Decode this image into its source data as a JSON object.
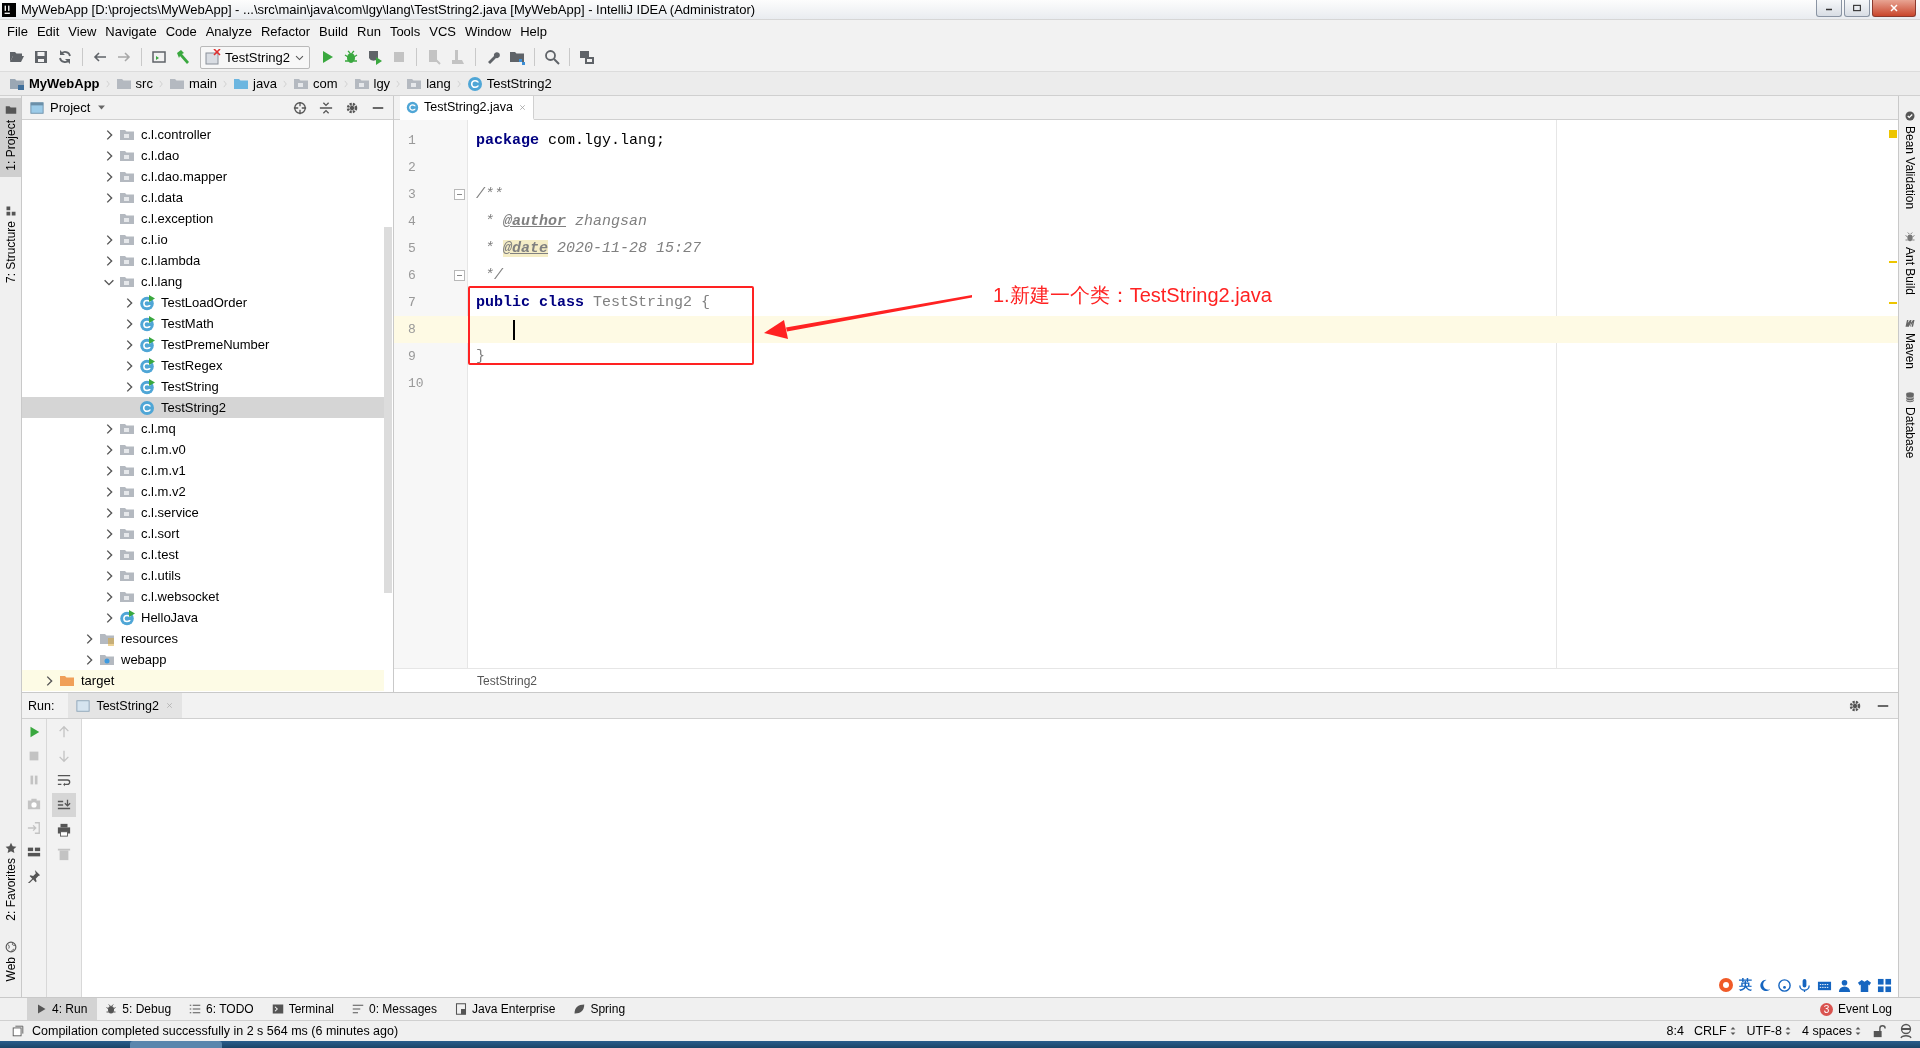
{
  "window": {
    "title": "MyWebApp [D:\\projects\\MyWebApp] - ...\\src\\main\\java\\com\\lgy\\lang\\TestString2.java [MyWebApp] - IntelliJ IDEA (Administrator)"
  },
  "menu": [
    "File",
    "Edit",
    "View",
    "Navigate",
    "Code",
    "Analyze",
    "Refactor",
    "Build",
    "Run",
    "Tools",
    "VCS",
    "Window",
    "Help"
  ],
  "toolbar": {
    "run_configuration": "TestString2"
  },
  "breadcrumbs": [
    {
      "label": "MyWebApp",
      "kind": "module"
    },
    {
      "label": "src",
      "kind": "folder"
    },
    {
      "label": "main",
      "kind": "folder"
    },
    {
      "label": "java",
      "kind": "source-folder"
    },
    {
      "label": "com",
      "kind": "package"
    },
    {
      "label": "lgy",
      "kind": "package"
    },
    {
      "label": "lang",
      "kind": "package"
    },
    {
      "label": "TestString2",
      "kind": "class"
    }
  ],
  "left_stripe": {
    "top": [
      {
        "label": "1: Project",
        "selected": true
      },
      {
        "label": "7: Structure",
        "selected": false
      }
    ],
    "bottom": [
      {
        "label": "2: Favorites",
        "selected": false
      },
      {
        "label": "Web",
        "selected": false
      }
    ]
  },
  "project": {
    "title": "Project",
    "tree": [
      {
        "children": [
          {
            "children": [
              {
                "children": [
                  {
                    "label": "c.l.controller",
                    "kind": "package",
                    "expandable": true,
                    "expanded": false,
                    "selected": false
                  },
                  {
                    "label": "c.l.dao",
                    "kind": "package",
                    "expandable": true,
                    "expanded": false,
                    "selected": false
                  },
                  {
                    "label": "c.l.dao.mapper",
                    "kind": "package",
                    "expandable": true,
                    "expanded": false,
                    "selected": false
                  },
                  {
                    "label": "c.l.data",
                    "kind": "package",
                    "expandable": true,
                    "expanded": false,
                    "selected": false
                  },
                  {
                    "label": "c.l.exception",
                    "kind": "package",
                    "expandable": false,
                    "selected": false
                  },
                  {
                    "label": "c.l.io",
                    "kind": "package",
                    "expandable": true,
                    "expanded": false,
                    "selected": false
                  },
                  {
                    "label": "c.l.lambda",
                    "kind": "package",
                    "expandable": true,
                    "expanded": false,
                    "selected": false
                  },
                  {
                    "label": "c.l.lang",
                    "kind": "package",
                    "expandable": true,
                    "expanded": true,
                    "selected": false,
                    "children": [
                      {
                        "label": "TestLoadOrder",
                        "kind": "main-class",
                        "expandable": true,
                        "expanded": false,
                        "selected": false
                      },
                      {
                        "label": "TestMath",
                        "kind": "main-class",
                        "expandable": true,
                        "expanded": false,
                        "selected": false
                      },
                      {
                        "label": "TestPremeNumber",
                        "kind": "main-class",
                        "expandable": true,
                        "expanded": false,
                        "selected": false
                      },
                      {
                        "label": "TestRegex",
                        "kind": "main-class",
                        "expandable": true,
                        "expanded": false,
                        "selected": false
                      },
                      {
                        "label": "TestString",
                        "kind": "main-class",
                        "expandable": true,
                        "expanded": false,
                        "selected": false
                      },
                      {
                        "label": "TestString2",
                        "kind": "class",
                        "expandable": false,
                        "selected": true
                      }
                    ]
                  },
                  {
                    "label": "c.l.mq",
                    "kind": "package",
                    "expandable": true,
                    "expanded": false,
                    "selected": false
                  },
                  {
                    "label": "c.l.m.v0",
                    "kind": "package",
                    "expandable": true,
                    "expanded": false,
                    "selected": false
                  },
                  {
                    "label": "c.l.m.v1",
                    "kind": "package",
                    "expandable": true,
                    "expanded": false,
                    "selected": false
                  },
                  {
                    "label": "c.l.m.v2",
                    "kind": "package",
                    "expandable": true,
                    "expanded": false,
                    "selected": false
                  },
                  {
                    "label": "c.l.service",
                    "kind": "package",
                    "expandable": true,
                    "expanded": false,
                    "selected": false
                  },
                  {
                    "label": "c.l.sort",
                    "kind": "package",
                    "expandable": true,
                    "expanded": false,
                    "selected": false
                  },
                  {
                    "label": "c.l.test",
                    "kind": "package",
                    "expandable": true,
                    "expanded": false,
                    "selected": false
                  },
                  {
                    "label": "c.l.utils",
                    "kind": "package",
                    "expandable": true,
                    "expanded": false,
                    "selected": false
                  },
                  {
                    "label": "c.l.websocket",
                    "kind": "package",
                    "expandable": true,
                    "expanded": false,
                    "selected": false
                  },
                  {
                    "label": "HelloJava",
                    "kind": "main-class",
                    "expandable": true,
                    "expanded": false,
                    "selected": false
                  }
                ]
              },
              {
                "label": "resources",
                "kind": "resources-folder",
                "expandable": true,
                "expanded": false,
                "selected": false
              },
              {
                "label": "webapp",
                "kind": "web-folder",
                "expandable": true,
                "expanded": false,
                "selected": false
              }
            ]
          }
        ]
      },
      {
        "label": "target",
        "kind": "excluded-folder",
        "expandable": true,
        "expanded": false,
        "selected": false
      }
    ]
  },
  "editor": {
    "tabs": [
      {
        "label": "TestString2.java",
        "selected": true
      }
    ],
    "lines": [
      {
        "number": "1",
        "fold": false,
        "current": false,
        "caret": false,
        "tokens": [
          {
            "kind": "keyword",
            "text": "package"
          },
          {
            "kind": "plain",
            "text": " com.lgy.lang;"
          }
        ]
      },
      {
        "number": "2",
        "fold": false,
        "current": false,
        "caret": false
      },
      {
        "number": "3",
        "fold": true,
        "current": false,
        "caret": false,
        "tokens": [
          {
            "kind": "comment",
            "text": "/**"
          }
        ]
      },
      {
        "number": "4",
        "fold": false,
        "current": false,
        "caret": false,
        "tokens": [
          {
            "kind": "comment",
            "text": " * "
          },
          {
            "kind": "doc-tag",
            "text": "@author"
          },
          {
            "kind": "comment",
            "text": " zhangsan"
          }
        ]
      },
      {
        "number": "5",
        "fold": false,
        "current": false,
        "caret": false,
        "tokens": [
          {
            "kind": "comment",
            "text": " * "
          },
          {
            "kind": "doc-tag-marked",
            "text": "@date"
          },
          {
            "kind": "comment",
            "text": " 2020-11-28 15:27"
          }
        ]
      },
      {
        "number": "6",
        "fold": true,
        "current": false,
        "caret": false,
        "tokens": [
          {
            "kind": "comment",
            "text": " */"
          }
        ]
      },
      {
        "number": "7",
        "fold": false,
        "current": false,
        "caret": false,
        "tokens": [
          {
            "kind": "keyword",
            "text": "public class"
          },
          {
            "kind": "unused",
            "text": " TestString2 {"
          }
        ]
      },
      {
        "number": "8",
        "fold": false,
        "current": true,
        "caret": true
      },
      {
        "number": "9",
        "fold": false,
        "current": false,
        "caret": false,
        "tokens": [
          {
            "kind": "unused",
            "text": "}"
          }
        ]
      },
      {
        "number": "10",
        "fold": false,
        "current": false,
        "caret": false
      }
    ],
    "breadcrumb": "TestString2",
    "annotation": "1.新建一个类：TestString2.java"
  },
  "right_stripe": [
    "Bean Validation",
    "Ant Build",
    "Maven",
    "Database"
  ],
  "run": {
    "label": "Run:",
    "tabs": [
      {
        "label": "TestString2",
        "selected": true
      }
    ],
    "scroll_to_end": true
  },
  "ime": {
    "language": "英"
  },
  "tool_tabs": [
    {
      "label": "4: Run",
      "selected": true
    },
    {
      "label": "5: Debug",
      "selected": false
    },
    {
      "label": "6: TODO",
      "selected": false
    },
    {
      "label": "Terminal",
      "selected": false
    },
    {
      "label": "0: Messages",
      "selected": false
    },
    {
      "label": "Java Enterprise",
      "selected": false
    },
    {
      "label": "Spring",
      "selected": false
    }
  ],
  "event_log": {
    "label": "Event Log",
    "count": "3"
  },
  "status": {
    "message": "Compilation completed successfully in 2 s 564 ms (6 minutes ago)",
    "position": "8:4",
    "line_separator": "CRLF",
    "encoding": "UTF-8",
    "indent": "4 spaces"
  }
}
